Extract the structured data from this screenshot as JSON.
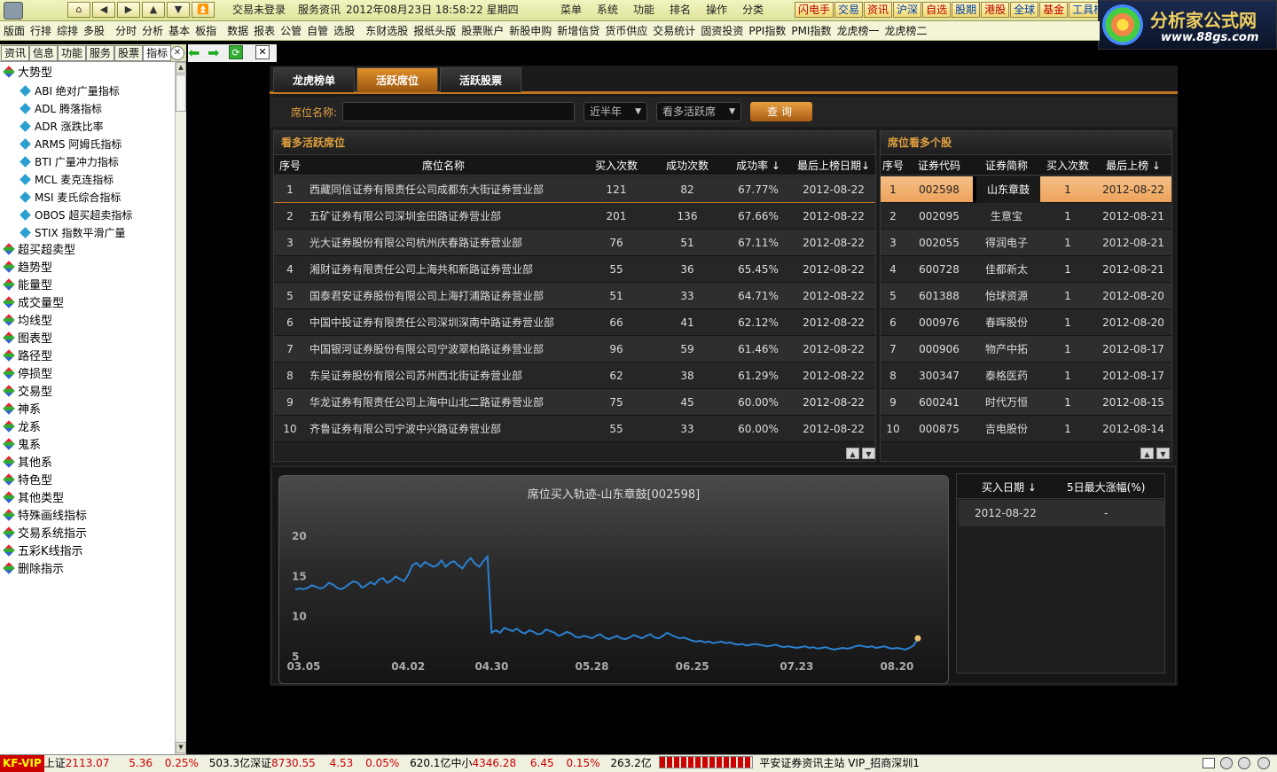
{
  "topbar": {
    "nav_icons": [
      "home-icon",
      "back-icon",
      "forward-icon",
      "up-icon",
      "down-icon",
      "top-icon"
    ],
    "login_status": "交易未登录",
    "service": "服务资讯",
    "datetime": "2012年08月23日 18:58:22 星期四",
    "menus": [
      "菜单",
      "系统",
      "功能",
      "排名",
      "操作",
      "分类"
    ],
    "quick": [
      "闪电手",
      "交易",
      "资讯",
      "沪深",
      "自选",
      "股期",
      "港股",
      "全球",
      "基金",
      "工具栏"
    ]
  },
  "logo": {
    "text": "分析家公式网",
    "url_text": "www.88gs.com"
  },
  "menubar": [
    "版面",
    "行排",
    "综排",
    "多股",
    "分时",
    "分析",
    "基本",
    "板指",
    "数据",
    "报表",
    "公管",
    "自管",
    "选股",
    "东财选股",
    "报纸头版",
    "股票账户",
    "新股申购",
    "新增信贷",
    "货币供应",
    "交易统计",
    "固资投资",
    "PPI指数",
    "PMI指数",
    "龙虎榜一",
    "龙虎榜二"
  ],
  "lefttabs": [
    "资讯",
    "信息",
    "功能",
    "服务",
    "股票",
    "指标"
  ],
  "tree": [
    {
      "label": "大势型",
      "type": "group"
    },
    {
      "label": "ABI 绝对广量指标",
      "type": "sub"
    },
    {
      "label": "ADL 腾落指标",
      "type": "sub"
    },
    {
      "label": "ADR 涨跌比率",
      "type": "sub"
    },
    {
      "label": "ARMS 阿姆氏指标",
      "type": "sub"
    },
    {
      "label": "BTI 广量冲力指标",
      "type": "sub"
    },
    {
      "label": "MCL 麦克连指标",
      "type": "sub"
    },
    {
      "label": "MSI 麦氏综合指标",
      "type": "sub"
    },
    {
      "label": "OBOS 超买超卖指标",
      "type": "sub"
    },
    {
      "label": "STIX 指数平滑广量",
      "type": "sub"
    },
    {
      "label": "超买超卖型",
      "type": "group"
    },
    {
      "label": "趋势型",
      "type": "group"
    },
    {
      "label": "能量型",
      "type": "group"
    },
    {
      "label": "成交量型",
      "type": "group"
    },
    {
      "label": "均线型",
      "type": "group"
    },
    {
      "label": "图表型",
      "type": "group"
    },
    {
      "label": "路径型",
      "type": "group"
    },
    {
      "label": "停损型",
      "type": "group"
    },
    {
      "label": "交易型",
      "type": "group"
    },
    {
      "label": "神系",
      "type": "group"
    },
    {
      "label": "龙系",
      "type": "group"
    },
    {
      "label": "鬼系",
      "type": "group"
    },
    {
      "label": "其他系",
      "type": "group"
    },
    {
      "label": "特色型",
      "type": "group"
    },
    {
      "label": "其他类型",
      "type": "group"
    },
    {
      "label": "特殊画线指标",
      "type": "group"
    },
    {
      "label": "交易系统指示",
      "type": "group"
    },
    {
      "label": "五彩K线指示",
      "type": "group"
    },
    {
      "label": "删除指示",
      "type": "group"
    }
  ],
  "main": {
    "tabs": [
      "龙虎榜单",
      "活跃席位",
      "活跃股票"
    ],
    "active_tab": 1,
    "filter": {
      "label": "席位名称:",
      "period": "近半年",
      "type": "看多活跃席",
      "query": "查询"
    },
    "left_table": {
      "title": "看多活跃席位",
      "columns": [
        "序号",
        "席位名称",
        "买入次数",
        "成功次数",
        "成功率 ↓",
        "最后上榜日期↓"
      ],
      "rows": [
        [
          "1",
          "西藏同信证券有限责任公司成都东大街证券营业部",
          "121",
          "82",
          "67.77%",
          "2012-08-22"
        ],
        [
          "2",
          "五矿证券有限公司深圳金田路证券营业部",
          "201",
          "136",
          "67.66%",
          "2012-08-22"
        ],
        [
          "3",
          "光大证券股份有限公司杭州庆春路证券营业部",
          "76",
          "51",
          "67.11%",
          "2012-08-22"
        ],
        [
          "4",
          "湘财证券有限责任公司上海共和新路证券营业部",
          "55",
          "36",
          "65.45%",
          "2012-08-22"
        ],
        [
          "5",
          "国泰君安证券股份有限公司上海打浦路证券营业部",
          "51",
          "33",
          "64.71%",
          "2012-08-22"
        ],
        [
          "6",
          "中国中投证券有限责任公司深圳深南中路证券营业部",
          "66",
          "41",
          "62.12%",
          "2012-08-22"
        ],
        [
          "7",
          "中国银河证券股份有限公司宁波翠柏路证券营业部",
          "96",
          "59",
          "61.46%",
          "2012-08-22"
        ],
        [
          "8",
          "东吴证券股份有限公司苏州西北街证券营业部",
          "62",
          "38",
          "61.29%",
          "2012-08-22"
        ],
        [
          "9",
          "华龙证券有限责任公司上海中山北二路证券营业部",
          "75",
          "45",
          "60.00%",
          "2012-08-22"
        ],
        [
          "10",
          "齐鲁证券有限公司宁波中兴路证券营业部",
          "55",
          "33",
          "60.00%",
          "2012-08-22"
        ]
      ]
    },
    "right_table": {
      "title": "席位看多个股",
      "columns": [
        "序号",
        "证券代码",
        "证券简称",
        "买入次数",
        "最后上榜 ↓"
      ],
      "rows": [
        [
          "1",
          "002598",
          "山东章鼓",
          "1",
          "2012-08-22"
        ],
        [
          "2",
          "002095",
          "生意宝",
          "1",
          "2012-08-21"
        ],
        [
          "3",
          "002055",
          "得润电子",
          "1",
          "2012-08-21"
        ],
        [
          "4",
          "600728",
          "佳都新太",
          "1",
          "2012-08-21"
        ],
        [
          "5",
          "601388",
          "怡球资源",
          "1",
          "2012-08-20"
        ],
        [
          "6",
          "000976",
          "春晖股份",
          "1",
          "2012-08-20"
        ],
        [
          "7",
          "000906",
          "物产中拓",
          "1",
          "2012-08-17"
        ],
        [
          "8",
          "300347",
          "泰格医药",
          "1",
          "2012-08-17"
        ],
        [
          "9",
          "600241",
          "时代万恒",
          "1",
          "2012-08-15"
        ],
        [
          "10",
          "000875",
          "吉电股份",
          "1",
          "2012-08-14"
        ]
      ]
    },
    "history": {
      "columns": [
        "买入日期 ↓",
        "5日最大涨幅(%)"
      ],
      "rows": [
        [
          "2012-08-22",
          "-"
        ]
      ]
    }
  },
  "chart_data": {
    "type": "line",
    "title": "席位买入轨迹-山东章鼓[002598]",
    "y_ticks": [
      "5",
      "10",
      "15",
      "20"
    ],
    "ylim": [
      5,
      22
    ],
    "x_tick_labels": [
      "03.05",
      "04.02",
      "04.30",
      "05.28",
      "06.25",
      "07.23",
      "08.20"
    ],
    "x_tick_index": [
      2,
      27,
      47,
      71,
      95,
      120,
      144
    ],
    "line_color": "#2a80d0",
    "marker_color": "#e8c070",
    "grid": false,
    "series": [
      {
        "values": [
          13.4,
          13.5,
          13.4,
          13.6,
          13.9,
          13.7,
          13.5,
          13.7,
          14.2,
          14.0,
          13.6,
          13.4,
          13.7,
          14.1,
          14.4,
          14.2,
          13.6,
          13.9,
          14.3,
          14.0,
          14.6,
          14.8,
          14.2,
          14.5,
          15.0,
          14.7,
          14.4,
          15.2,
          16.4,
          16.7,
          16.2,
          16.8,
          16.5,
          16.2,
          16.4,
          17.0,
          16.2,
          16.7,
          16.9,
          16.4,
          16.0,
          16.8,
          17.3,
          16.6,
          16.2,
          16.9,
          17.5,
          8.0,
          8.3,
          8.0,
          8.6,
          8.4,
          8.2,
          8.5,
          8.1,
          7.9,
          8.3,
          8.1,
          7.8,
          7.9,
          8.4,
          8.2,
          8.0,
          7.6,
          7.8,
          8.1,
          7.9,
          7.5,
          7.4,
          7.6,
          7.5,
          7.3,
          7.6,
          7.8,
          7.4,
          7.2,
          7.4,
          7.6,
          7.3,
          7.2,
          7.4,
          7.7,
          7.5,
          7.3,
          7.6,
          7.8,
          7.4,
          7.3,
          7.6,
          8.0,
          7.7,
          7.5,
          7.3,
          7.4,
          7.2,
          7.0,
          6.9,
          7.0,
          6.8,
          6.9,
          6.7,
          6.8,
          6.9,
          6.7,
          6.8,
          6.6,
          6.5,
          6.6,
          6.4,
          6.5,
          6.6,
          6.5,
          6.4,
          6.3,
          6.4,
          6.5,
          6.3,
          6.2,
          6.3,
          6.2,
          6.1,
          6.2,
          6.3,
          6.1,
          6.2,
          6.0,
          6.1,
          6.2,
          6.0,
          5.9,
          6.0,
          6.1,
          6.0,
          6.1,
          6.3,
          6.4,
          6.3,
          6.2,
          6.3,
          6.1,
          6.2,
          6.3,
          6.1,
          6.0,
          6.1,
          6.0,
          5.9,
          6.1,
          6.4,
          7.3
        ]
      }
    ]
  },
  "statusbar": {
    "kf": "KF-VIP",
    "sh_label": "上证",
    "sh_index": "2113.07",
    "sh_chg": "5.36",
    "sh_pct": "0.25%",
    "sh_amt": "503.3亿",
    "sz_label": "深证",
    "sz_index": "8730.55",
    "sz_chg": "4.53",
    "sz_pct": "0.05%",
    "sz_amt": "620.1亿",
    "zx_label": "中小",
    "zx_index": "4346.28",
    "zx_chg": "6.45",
    "zx_pct": "0.15%",
    "zx_amt": "263.2亿",
    "station": "平安证券资讯主站 VIP_招商深圳1"
  }
}
